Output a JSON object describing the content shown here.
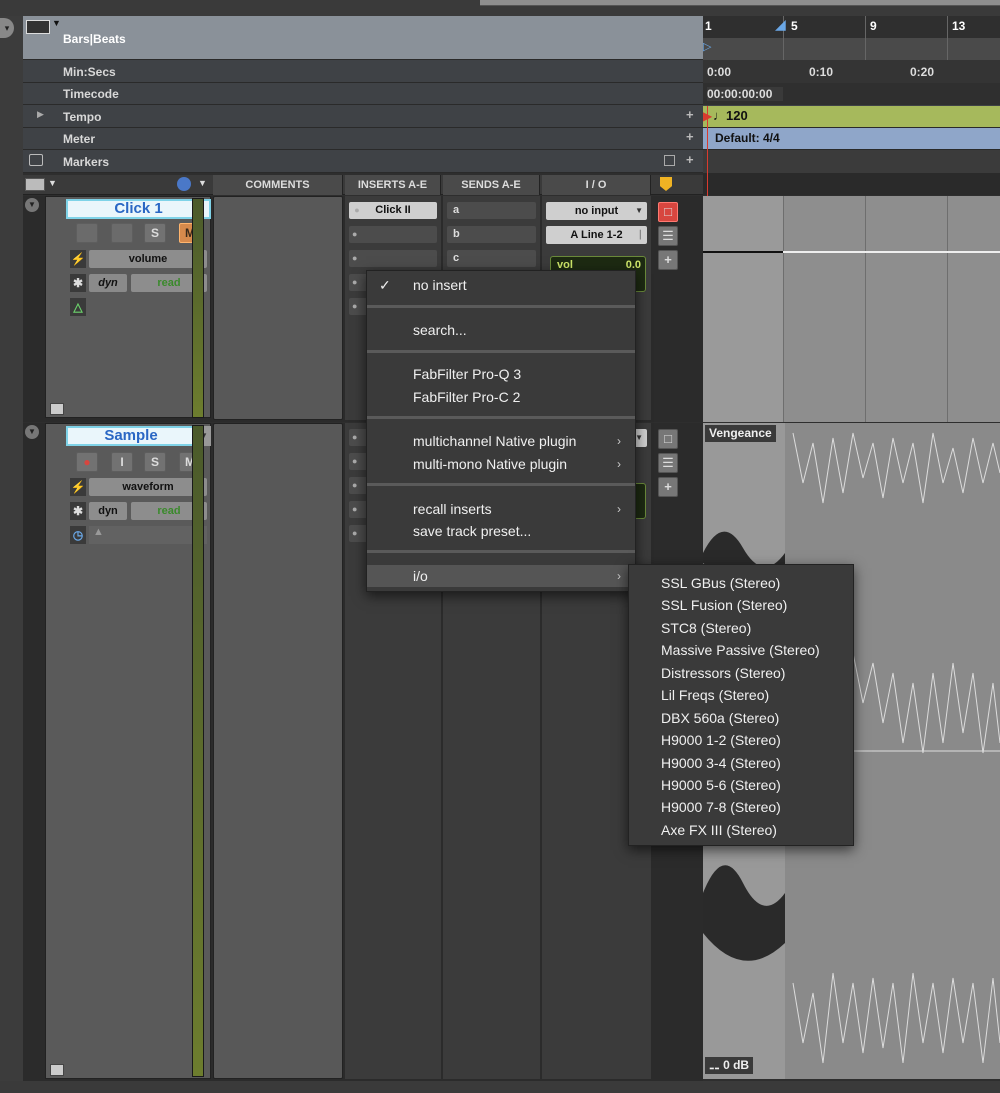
{
  "rulers": {
    "bars_beats": "Bars|Beats",
    "min_secs": "Min:Secs",
    "timecode": "Timecode",
    "tempo": "Tempo",
    "meter": "Meter",
    "markers": "Markers",
    "bar_numbers": [
      "1",
      "5",
      "9",
      "13"
    ],
    "time_marks": [
      "0:00",
      "0:10",
      "0:20"
    ],
    "timecode_value": "00:00:00:00",
    "tempo_value": "120",
    "meter_value": "Default: 4/4"
  },
  "columns": {
    "comments": "COMMENTS",
    "inserts": "INSERTS A-E",
    "sends": "SENDS A-E",
    "io": "I / O"
  },
  "tracks": [
    {
      "name": "Click 1",
      "view": "volume",
      "dyn": "dyn",
      "automation": "read",
      "solo": "S",
      "mute": "M",
      "insert_a": "Click II",
      "sends": [
        "a",
        "b",
        "c"
      ],
      "input": "no input",
      "output": "A Line 1-2",
      "vol_label": "vol",
      "vol_value": "0.0"
    },
    {
      "name": "Sample",
      "view": "waveform",
      "dyn": "dyn",
      "automation": "read",
      "input_mon": "I",
      "solo": "S",
      "mute": "M",
      "clip_name": "Vengeance",
      "clip_gain": "0 dB"
    }
  ],
  "insert_menu": {
    "items": [
      {
        "label": "no insert",
        "checked": true
      },
      {
        "label": "search..."
      },
      {
        "label": "FabFilter Pro-Q 3"
      },
      {
        "label": "FabFilter Pro-C 2"
      },
      {
        "label": "multichannel Native plugin",
        "submenu": true
      },
      {
        "label": "multi-mono Native plugin",
        "submenu": true
      },
      {
        "label": "recall inserts",
        "submenu": true
      },
      {
        "label": "save track preset..."
      },
      {
        "label": "i/o",
        "submenu": true,
        "highlighted": true
      }
    ]
  },
  "io_submenu": {
    "items": [
      "SSL GBus (Stereo)",
      "SSL Fusion (Stereo)",
      "STC8 (Stereo)",
      "Massive Passive (Stereo)",
      "Distressors (Stereo)",
      "Lil Freqs (Stereo)",
      "DBX 560a (Stereo)",
      "H9000 1-2 (Stereo)",
      "H9000 3-4 (Stereo)",
      "H9000 5-6 (Stereo)",
      "H9000 7-8 (Stereo)",
      "Axe FX III (Stereo)"
    ]
  },
  "colors": {
    "tempo_bar": "#a6b95c",
    "meter_bar": "#8fa6c9",
    "track_name_text": "#2a67c4",
    "mute_active": "#d78a4c",
    "record_red": "#d7463f",
    "playhead": "#d93a2e"
  }
}
